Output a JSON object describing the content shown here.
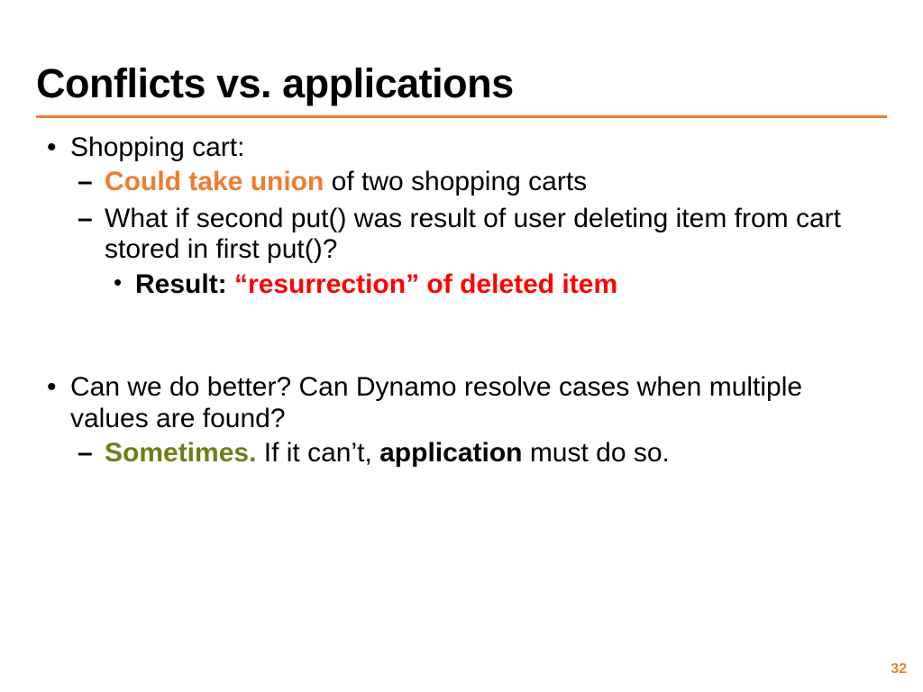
{
  "slide": {
    "title": "Conflicts vs. applications",
    "page_number": "32",
    "b1": {
      "label": "Shopping cart:",
      "s1_orange": "Could take union",
      "s1_rest": " of two shopping carts",
      "s2": "What if second put() was result of user deleting item from cart stored in first put()?",
      "s2a_label": "Result: ",
      "s2a_red": "“resurrection” of deleted item"
    },
    "b2": {
      "label": "Can we do better? Can Dynamo resolve cases when multiple values are found?",
      "s1_olive": "Sometimes.",
      "s1_mid": " If it can’t, ",
      "s1_bold": "application",
      "s1_end": " must do so."
    }
  }
}
